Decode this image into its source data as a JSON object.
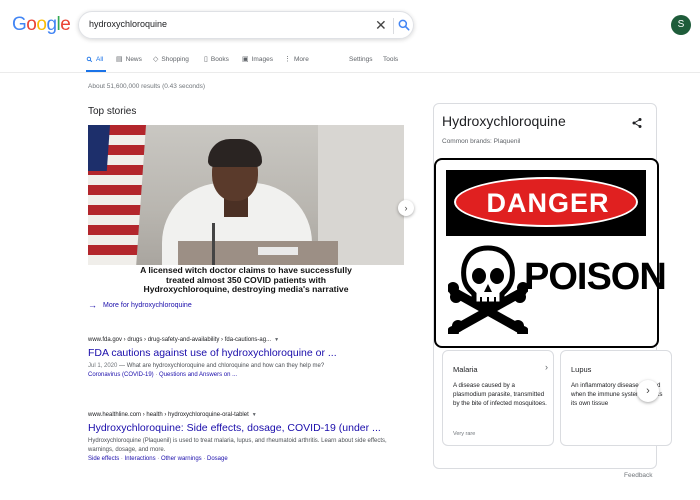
{
  "header": {
    "logo_letters": [
      "G",
      "o",
      "o",
      "g",
      "l",
      "e"
    ],
    "logo_colors": [
      "#4285f4",
      "#ea4335",
      "#fbbc05",
      "#4285f4",
      "#34a853",
      "#ea4335"
    ],
    "query": "hydroxychloroquine",
    "avatar_initial": "S",
    "avatar_color": "#1e5c3a"
  },
  "tabs": [
    {
      "label": "All",
      "icon": "search-icon",
      "active": true
    },
    {
      "label": "News",
      "icon": "news-icon",
      "active": false
    },
    {
      "label": "Shopping",
      "icon": "tag-icon",
      "active": false
    },
    {
      "label": "Books",
      "icon": "book-icon",
      "active": false
    },
    {
      "label": "Images",
      "icon": "image-icon",
      "active": false
    },
    {
      "label": "More",
      "icon": "more-vertical-icon",
      "active": false
    },
    {
      "label": "Settings",
      "icon": "",
      "active": false
    },
    {
      "label": "Tools",
      "icon": "",
      "active": false
    }
  ],
  "stats": "About 51,600,000 results (0.43 seconds)",
  "top_stories": {
    "title": "Top stories",
    "caption": "A licensed witch doctor claims to have successfully\ntreated almost 350 COVID patients with\nHydroxychloroquine, destroying media's narrative",
    "more_link": "More for hydroxychloroquine"
  },
  "results": [
    {
      "crumb": "www.fda.gov › drugs › drug-safety-and-availability › fda-cautions-ag...",
      "title": "FDA cautions against use of hydroxychloroquine or ...",
      "date": "Jul 1, 2020",
      "snippet": " — What are hydroxychloroquine and chloroquine and how can they help me?",
      "links": [
        "Coronavirus (COVID-19)",
        "Questions and Answers on ..."
      ]
    },
    {
      "crumb": "www.healthline.com › health › hydroxychloroquine-oral-tablet",
      "title": "Hydroxychloroquine: Side effects, dosage, COVID-19 (under ...",
      "date": "",
      "snippet": "Hydroxychloroquine (Plaquenil) is used to treat malaria, lupus, and rheumatoid arthritis. Learn about side effects, warnings, dosage, and more.",
      "links": [
        "Side effects",
        "Interactions",
        "Other warnings",
        "Dosage"
      ]
    }
  ],
  "knowledge_panel": {
    "title": "Hydroxychloroquine",
    "subtitle": "Common brands: Plaquenil",
    "sign_top": "DANGER",
    "sign_bottom": "POISON",
    "cards": [
      {
        "name": "Malaria",
        "desc": "A disease caused by a plasmodium parasite, transmitted by the bite of infected mosquitoes.",
        "tag": "Very rare"
      },
      {
        "name": "Lupus",
        "desc": "An inflammatory disease caused when the immune system attacks its own tissue",
        "tag": ""
      }
    ],
    "feedback": "Feedback"
  }
}
